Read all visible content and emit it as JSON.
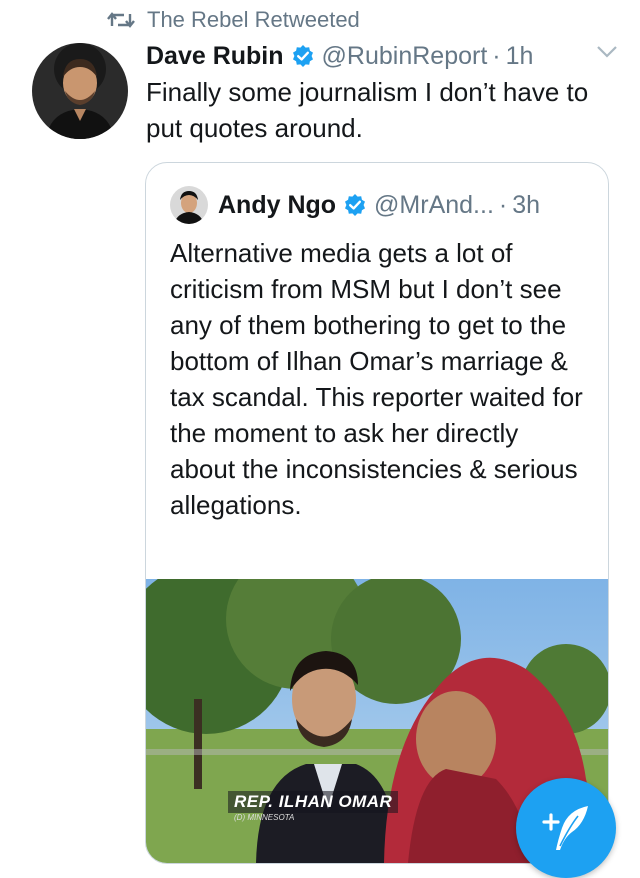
{
  "retweet_context": {
    "label": "The Rebel Retweeted"
  },
  "tweet": {
    "author_name": "Dave Rubin",
    "handle": "@RubinReport",
    "separator": "·",
    "time": "1h",
    "text": "Finally some journalism I don’t have to put quotes around."
  },
  "quoted_tweet": {
    "author_name": "Andy Ngo",
    "handle": "@MrAnd...",
    "separator": "·",
    "time": "3h",
    "text": "Alternative media gets a lot of criticism from MSM but I don’t see any of them bothering to get to the bottom of Ilhan Omar’s marriage & tax scandal. This reporter waited for the moment to ask her directly about the inconsistencies & serious allegations.",
    "media": {
      "caption_name": "REP. ILHAN OMAR",
      "caption_sub": "(D) MINNESOTA"
    }
  },
  "colors": {
    "accent": "#1da1f2",
    "text_primary": "#14171a",
    "text_secondary": "#657786",
    "border": "#ccd6dd"
  },
  "icons": [
    "retweet-icon",
    "verified-badge-icon",
    "chevron-down-icon",
    "compose-tweet-icon"
  ]
}
